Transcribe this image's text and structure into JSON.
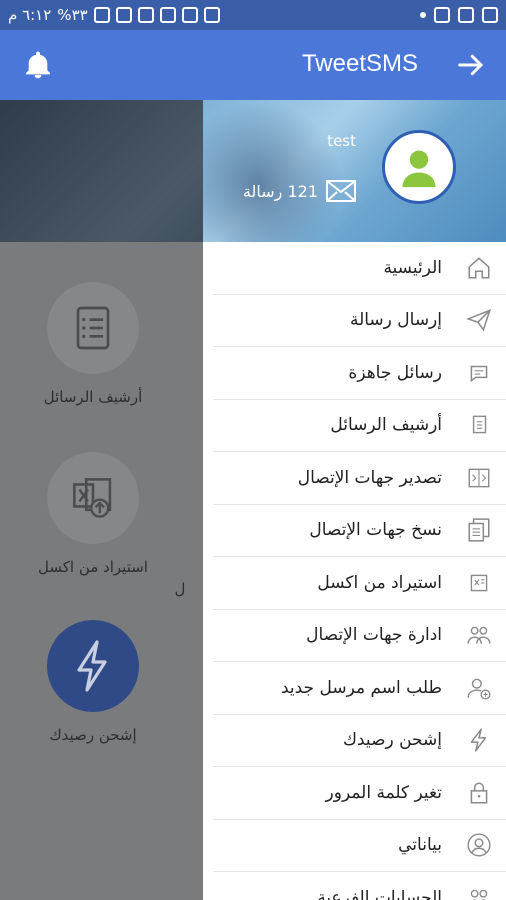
{
  "status_bar": {
    "time": "٦:١٢ م",
    "battery": "%٣٣"
  },
  "app_bar": {
    "title": "TweetSMS"
  },
  "background": {
    "tiles": [
      {
        "label": "أرشيف الرسائل",
        "icon": "document-list-icon"
      },
      {
        "label": "استيراد من اكسل",
        "icon": "excel-upload-icon"
      },
      {
        "label": "إشحن رصيدك",
        "icon": "lightning-icon"
      },
      {
        "label": "ل",
        "icon": "none"
      },
      {
        "label": "",
        "icon": "none"
      }
    ]
  },
  "drawer": {
    "user_name": "test",
    "message_count": "121 رسالة",
    "items": [
      {
        "label": "الرئيسية",
        "icon": "home-icon"
      },
      {
        "label": "إرسال رسالة",
        "icon": "send-icon"
      },
      {
        "label": "رسائل جاهزة",
        "icon": "chat-bubble-icon"
      },
      {
        "label": "أرشيف الرسائل",
        "icon": "document-icon"
      },
      {
        "label": "تصدير جهات الإتصال",
        "icon": "export-contacts-icon"
      },
      {
        "label": "نسخ جهات الإتصال",
        "icon": "copy-icon"
      },
      {
        "label": "استيراد من اكسل",
        "icon": "excel-icon"
      },
      {
        "label": "ادارة جهات الإتصال",
        "icon": "contacts-group-icon"
      },
      {
        "label": "طلب اسم مرسل جديد",
        "icon": "add-user-icon"
      },
      {
        "label": "إشحن رصيدك",
        "icon": "lightning-icon"
      },
      {
        "label": "تغير كلمة المرور",
        "icon": "lock-icon"
      },
      {
        "label": "بياناتي",
        "icon": "profile-icon"
      },
      {
        "label": "الحسابات الفرعية",
        "icon": "sub-accounts-icon"
      }
    ]
  },
  "colors": {
    "app_bar": "#4a77d8",
    "status_bar": "#3b5ea8",
    "avatar_green": "#8cc63f",
    "avatar_border": "#2f5fb3"
  }
}
